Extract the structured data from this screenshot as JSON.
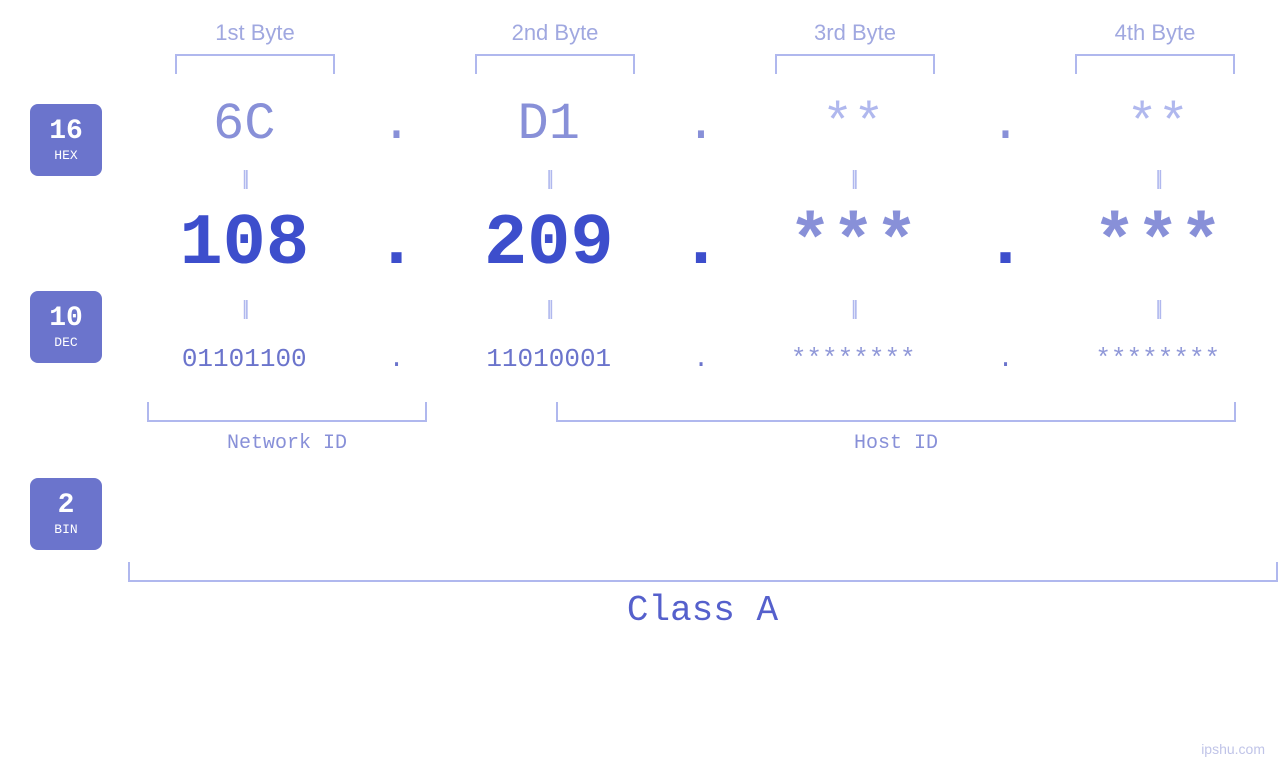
{
  "header": {
    "byte1": "1st Byte",
    "byte2": "2nd Byte",
    "byte3": "3rd Byte",
    "byte4": "4th Byte"
  },
  "badges": {
    "hex": {
      "num": "16",
      "label": "HEX"
    },
    "dec": {
      "num": "10",
      "label": "DEC"
    },
    "bin": {
      "num": "2",
      "label": "BIN"
    }
  },
  "hex_row": {
    "b1": "6C",
    "b2": "D1",
    "b3": "**",
    "b4": "**",
    "dot": "."
  },
  "dec_row": {
    "b1": "108",
    "b2": "209",
    "b3": "***",
    "b4": "***",
    "dot": "."
  },
  "bin_row": {
    "b1": "01101100",
    "b2": "11010001",
    "b3": "********",
    "b4": "********",
    "dot": "."
  },
  "labels": {
    "network": "Network ID",
    "host": "Host ID"
  },
  "class": {
    "label": "Class A"
  },
  "watermark": "ipshu.com"
}
